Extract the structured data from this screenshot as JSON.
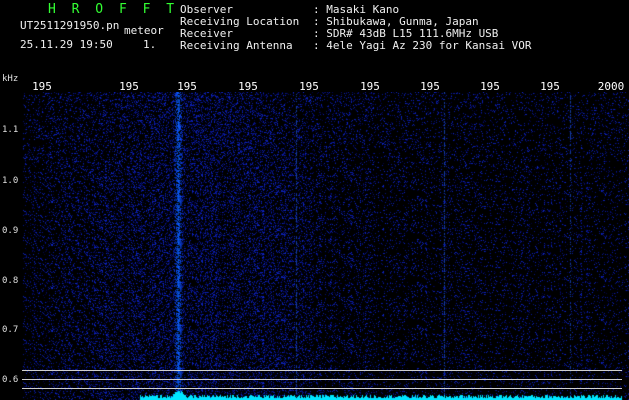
{
  "header": {
    "brand": "H R O F F T",
    "filename": "UT2511291950.pn",
    "mode": "meteor",
    "datetime": "25.11.29 19:50",
    "scale": "1.",
    "info": [
      {
        "key": "Observer",
        "value": ": Masaki Kano"
      },
      {
        "key": "Receiving Location",
        "value": ": Shibukawa, Gunma, Japan"
      },
      {
        "key": "Receiver",
        "value": ": SDR# 43dB L15 111.6MHz USB"
      },
      {
        "key": "Receiving Antenna",
        "value": ": 4ele Yagi Az 230 for Kansai VOR"
      }
    ]
  },
  "axis": {
    "ylabel": "kHz",
    "xticks": [
      "195",
      "195",
      "195",
      "195",
      "195",
      "195",
      "195",
      "195",
      "195",
      "2000"
    ],
    "yticks": [
      "1.1",
      "1.0",
      "0.9",
      "0.8",
      "0.7",
      "0.6"
    ]
  },
  "colors": {
    "background": "#000000",
    "brand": "#33ff33",
    "signal": "#3c5cff",
    "meteor_trace": "#00e5ff",
    "gridline": "#cfcfcf"
  }
}
